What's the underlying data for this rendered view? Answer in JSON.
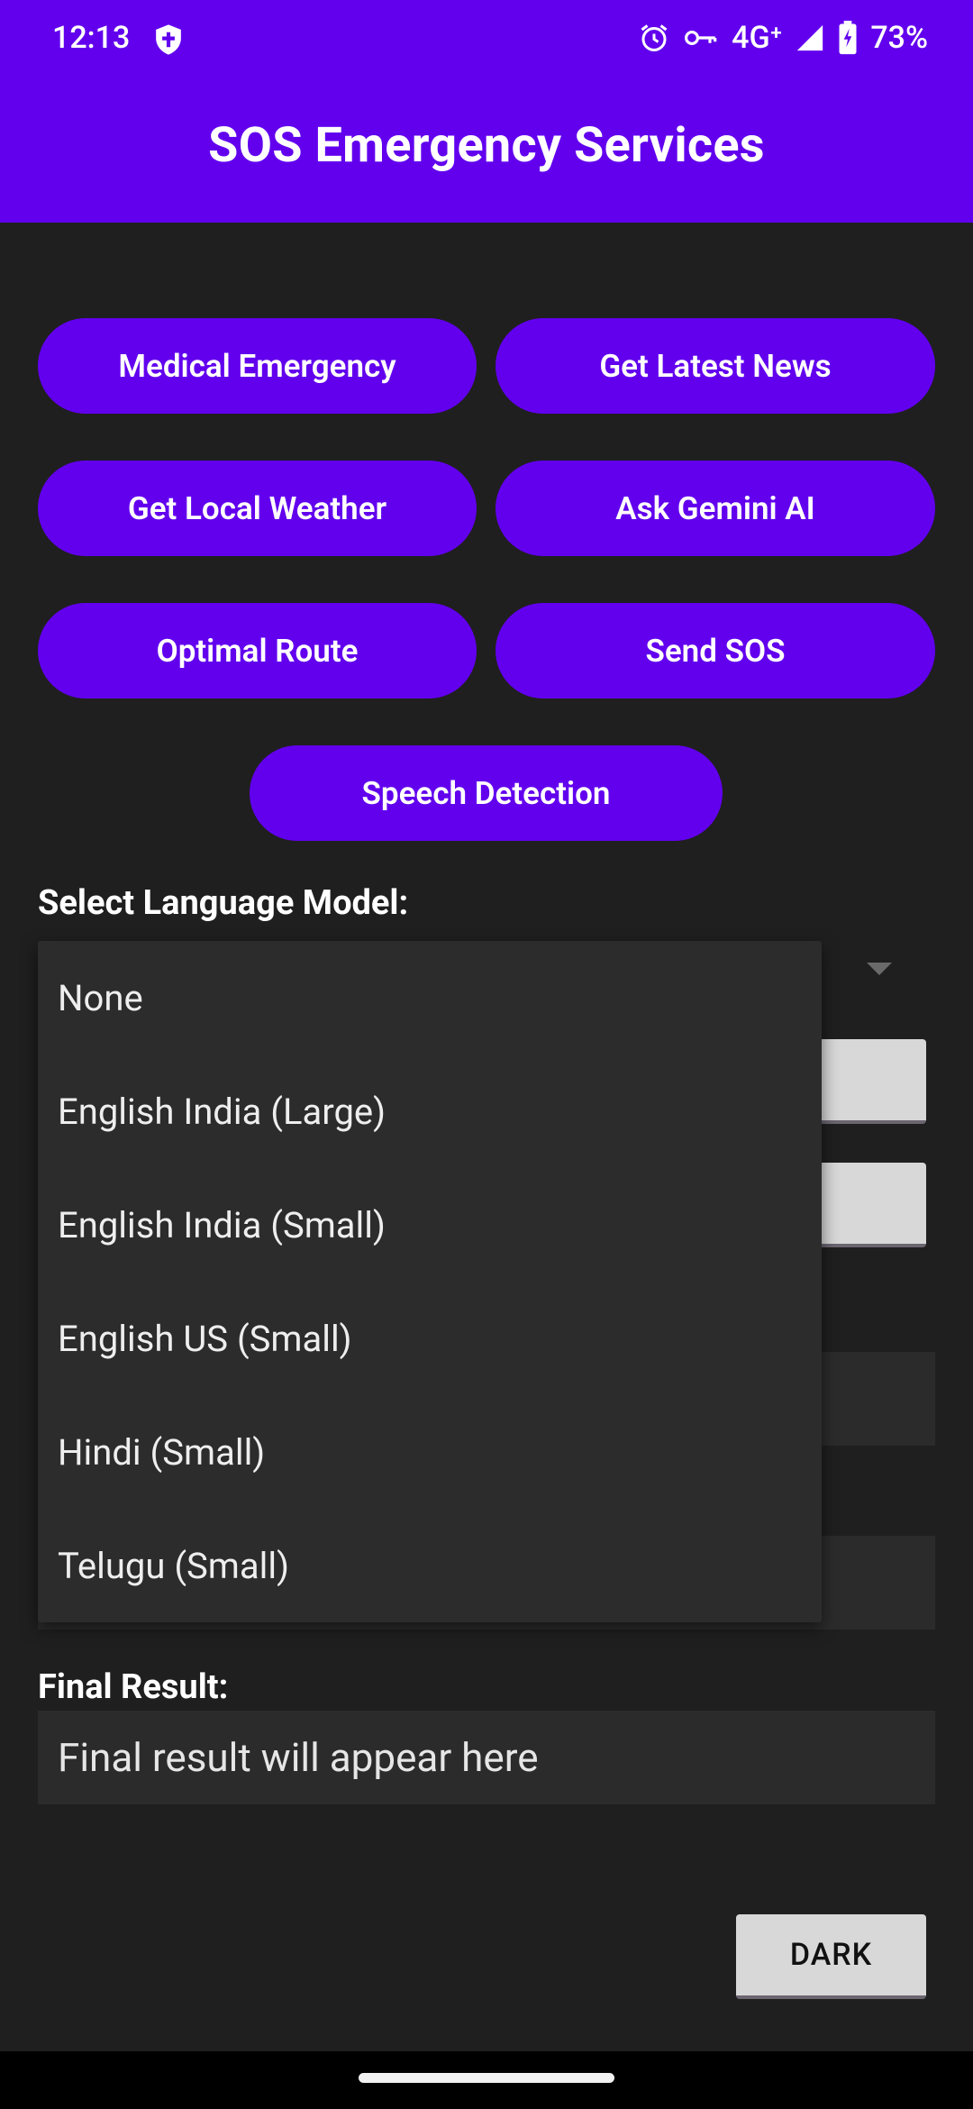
{
  "status_bar": {
    "time": "12:13",
    "network": "4G⁺",
    "battery": "73%",
    "icons": [
      "shield-icon",
      "alarm-icon",
      "vpn-key-icon",
      "signal-icon",
      "battery-charging-icon"
    ]
  },
  "app_bar": {
    "title": "SOS Emergency Services"
  },
  "buttons": {
    "medical": "Medical Emergency",
    "news": "Get Latest News",
    "weather": "Get Local Weather",
    "gemini": "Ask Gemini AI",
    "route": "Optimal Route",
    "sos": "Send SOS",
    "speech": "Speech Detection"
  },
  "language": {
    "label": "Select Language Model:",
    "options": [
      "None",
      "English India (Large)",
      "English India (Small)",
      "English US (Small)",
      "Hindi (Small)",
      "Telugu (Small)"
    ]
  },
  "final_result": {
    "label": "Final Result:",
    "placeholder": "Final result will appear here"
  },
  "theme_button": "DARK",
  "colors": {
    "accent": "#6200ee",
    "background": "#1f1f1f",
    "surface": "#2c2c2c"
  }
}
